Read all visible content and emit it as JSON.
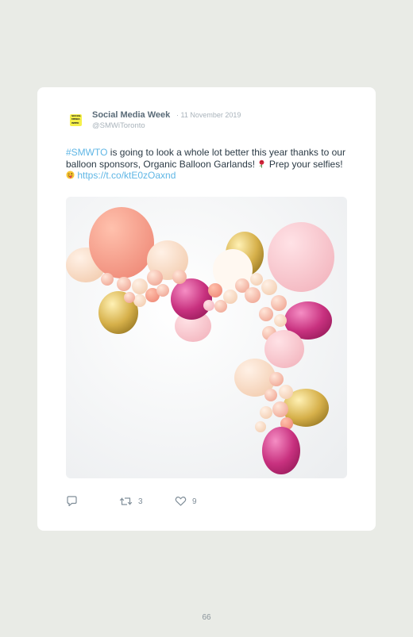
{
  "tweet": {
    "author_name": "Social Media Week",
    "date": "· 11 November 2019",
    "handle": "@SMWiToronto",
    "avatar_text": [
      "SOCIAL",
      "MEDIA",
      "WEEK"
    ],
    "text": {
      "hashtag": "#SMWTO",
      "part1": " is going to look a whole lot better this year thanks to our balloon sponsors, Organic Balloon Garlands! ",
      "part2": " Prep your selfies! ",
      "link": "https://t.co/ktE0zOaxnd"
    },
    "media": {
      "icon": "balloon-garland-photo"
    },
    "actions": {
      "reply": {
        "icon": "reply-icon",
        "count": ""
      },
      "retweet": {
        "icon": "retweet-icon",
        "count": "3"
      },
      "like": {
        "icon": "heart-icon",
        "count": "9"
      }
    }
  },
  "page": {
    "number": "66"
  },
  "colors": {
    "background": "#e9ebe6",
    "card": "#ffffff",
    "link": "#5fb6e5",
    "avatar": "#f5f049"
  }
}
